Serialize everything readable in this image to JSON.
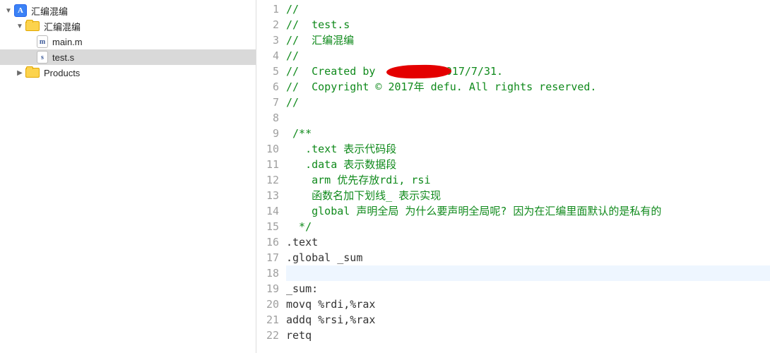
{
  "sidebar": {
    "items": [
      {
        "label": "汇编混编",
        "type": "proj",
        "indent": 0,
        "expanded": true
      },
      {
        "label": "汇编混编",
        "type": "folder",
        "indent": 1,
        "expanded": true
      },
      {
        "label": "main.m",
        "type": "file",
        "indent": 2,
        "letter": "m"
      },
      {
        "label": "test.s",
        "type": "file",
        "indent": 2,
        "letter": "s",
        "selected": true
      },
      {
        "label": "Products",
        "type": "folder",
        "indent": 1,
        "expanded": false
      }
    ]
  },
  "editor": {
    "lines": [
      {
        "n": 1,
        "t": "//",
        "cls": "cm"
      },
      {
        "n": 2,
        "t": "//  test.s",
        "cls": "cm"
      },
      {
        "n": 3,
        "t": "//  汇编混编",
        "cls": "cm"
      },
      {
        "n": 4,
        "t": "//",
        "cls": "cm"
      },
      {
        "n": 5,
        "t": "//  Created by          2017/7/31.",
        "cls": "cm",
        "redact": true
      },
      {
        "n": 6,
        "t": "//  Copyright © 2017年 defu. All rights reserved.",
        "cls": "cm"
      },
      {
        "n": 7,
        "t": "//",
        "cls": "cm"
      },
      {
        "n": 8,
        "t": "",
        "cls": ""
      },
      {
        "n": 9,
        "t": " /**",
        "cls": "cm"
      },
      {
        "n": 10,
        "t": "   .text 表示代码段",
        "cls": "cm"
      },
      {
        "n": 11,
        "t": "   .data 表示数据段",
        "cls": "cm"
      },
      {
        "n": 12,
        "t": "    arm 优先存放rdi, rsi",
        "cls": "cm"
      },
      {
        "n": 13,
        "t": "    函数名加下划线_ 表示实现",
        "cls": "cm"
      },
      {
        "n": 14,
        "t": "    global 声明全局 为什么要声明全局呢? 因为在汇编里面默认的是私有的",
        "cls": "cm"
      },
      {
        "n": 15,
        "t": "  */",
        "cls": "cm"
      },
      {
        "n": 16,
        "t": ".text",
        "cls": ""
      },
      {
        "n": 17,
        "t": ".global _sum",
        "cls": ""
      },
      {
        "n": 18,
        "t": "",
        "cls": "",
        "current": true
      },
      {
        "n": 19,
        "t": "_sum:",
        "cls": ""
      },
      {
        "n": 20,
        "t": "movq %rdi,%rax",
        "cls": ""
      },
      {
        "n": 21,
        "t": "addq %rsi,%rax",
        "cls": ""
      },
      {
        "n": 22,
        "t": "retq",
        "cls": ""
      }
    ]
  },
  "icons": {
    "proj_letter": "A"
  }
}
